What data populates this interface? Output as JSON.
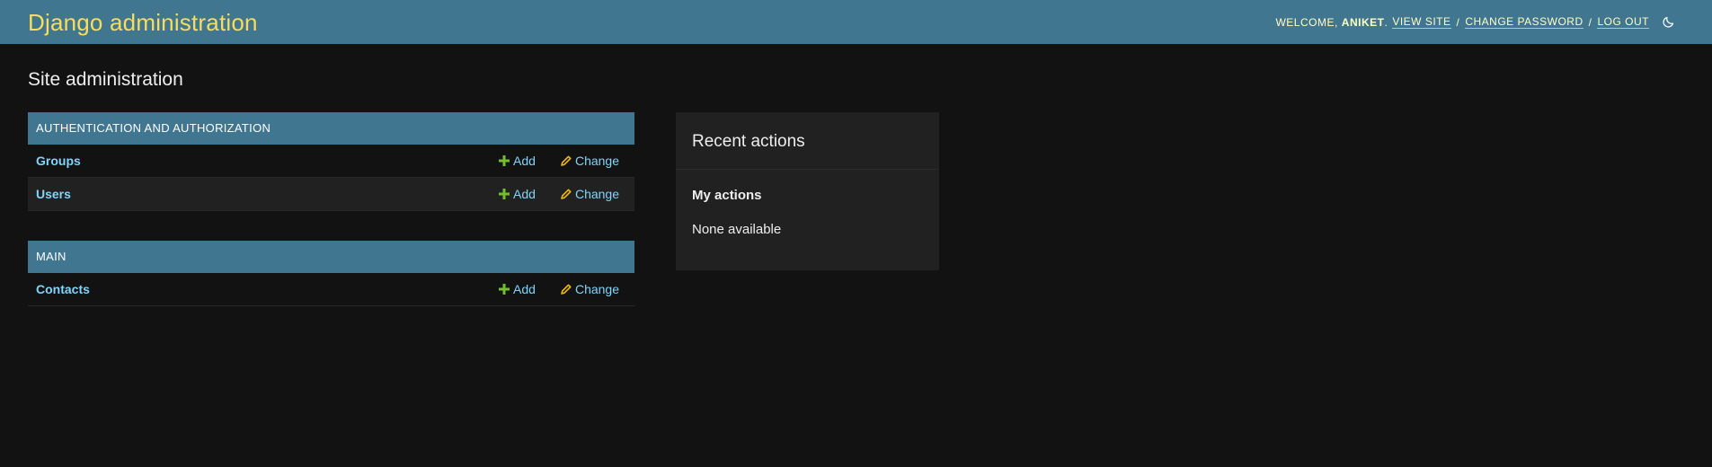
{
  "header": {
    "branding": "Django administration",
    "welcome": "Welcome,",
    "username": "aniket",
    "username_suffix": ".",
    "view_site": "View site",
    "change_password": "Change password",
    "log_out": "Log out",
    "separator": "/",
    "theme_icon": "moon-icon"
  },
  "page": {
    "title": "Site administration"
  },
  "apps": [
    {
      "caption": "Authentication and Authorization",
      "models": [
        {
          "name": "Groups",
          "add": "Add",
          "change": "Change"
        },
        {
          "name": "Users",
          "add": "Add",
          "change": "Change"
        }
      ]
    },
    {
      "caption": "Main",
      "models": [
        {
          "name": "Contacts",
          "add": "Add",
          "change": "Change"
        }
      ]
    }
  ],
  "recent_actions": {
    "title": "Recent actions",
    "subtitle": "My actions",
    "empty": "None available"
  },
  "colors": {
    "header_bg": "#417690",
    "branding": "#f5dd5d",
    "link": "#81d4fa",
    "add_icon": "#70bf2b",
    "change_icon": "#efb80b",
    "background": "#121212"
  },
  "icons": {
    "add": "plus-icon",
    "change": "pencil-icon"
  }
}
